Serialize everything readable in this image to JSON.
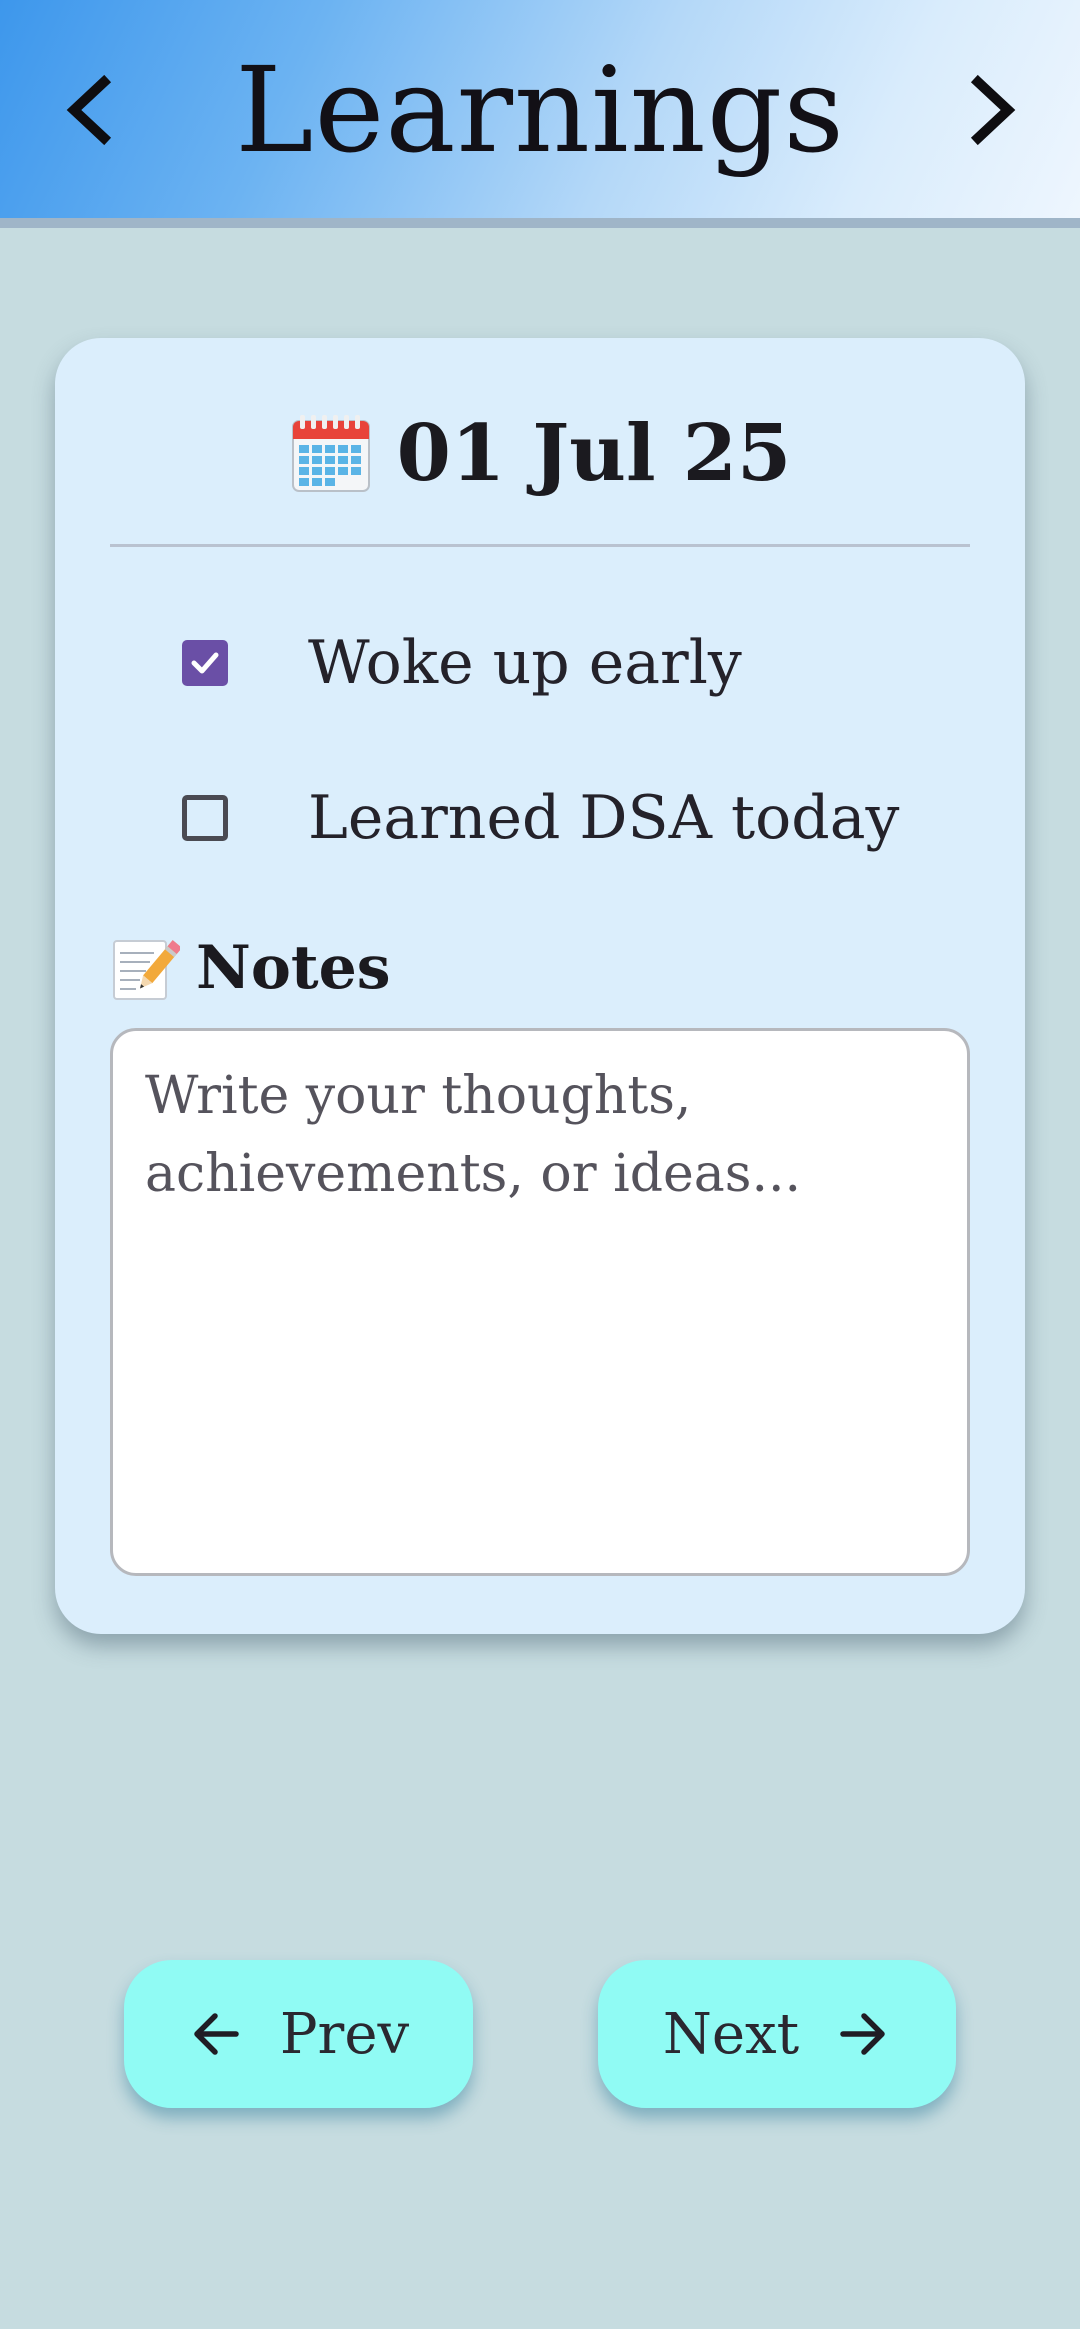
{
  "header": {
    "title": "Learnings",
    "prev_icon": "chevron-left-icon",
    "next_icon": "chevron-right-icon"
  },
  "entry": {
    "date_icon": "calendar-icon",
    "date": "01 Jul 25",
    "habits": [
      {
        "label": "Woke up early",
        "checked": true
      },
      {
        "label": "Learned DSA today",
        "checked": false
      }
    ],
    "notes": {
      "icon": "memo-icon",
      "label": "Notes",
      "value": "",
      "placeholder": "Write your thoughts, achievements, or ideas..."
    }
  },
  "footer": {
    "prev_label": "Prev",
    "next_label": "Next",
    "prev_icon": "arrow-left-icon",
    "next_icon": "arrow-right-icon"
  },
  "colors": {
    "background": "#c6dce0",
    "card": "#dbeefc",
    "checkbox_checked": "#6a4fa6",
    "button": "#90fbf4",
    "header_gradient_start": "#3d97ec",
    "header_gradient_end": "#eef6fe"
  }
}
